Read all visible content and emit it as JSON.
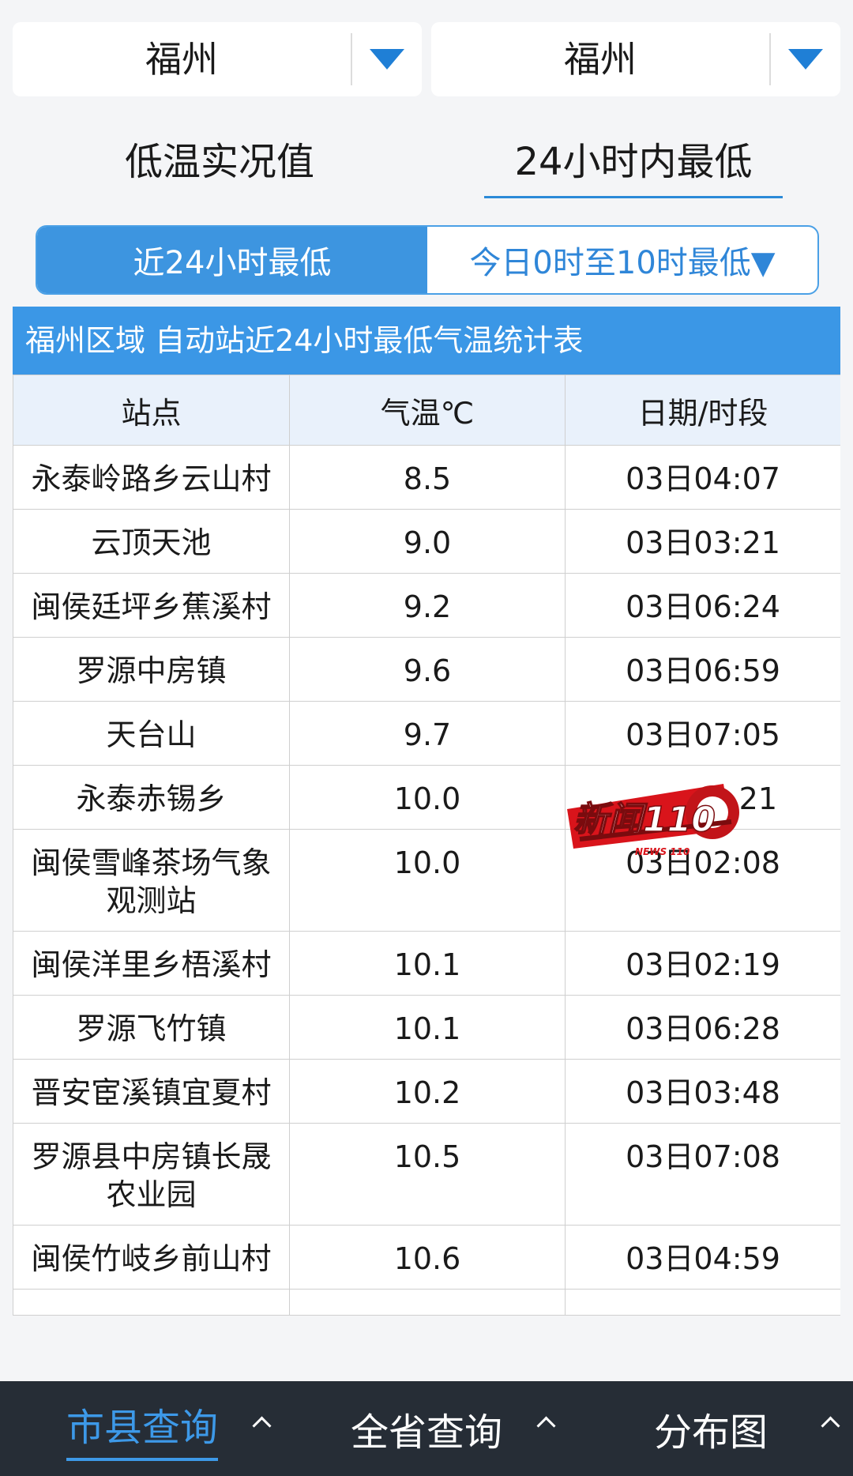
{
  "selectors": {
    "left": {
      "value": "福州"
    },
    "right": {
      "value": "福州"
    }
  },
  "mode_tabs": [
    {
      "label": "低温实况值",
      "active": false
    },
    {
      "label": "24小时内最低",
      "active": true
    }
  ],
  "segment": {
    "left_label": "近24小时最低",
    "right_label": "今日0时至10时最低▼"
  },
  "table": {
    "title": "福州区域 自动站近24小时最低气温统计表",
    "headers": [
      "站点",
      "气温℃",
      "日期/时段"
    ],
    "rows": [
      {
        "station": "永泰岭路乡云山村",
        "temp": "8.5",
        "time": "03日04:07"
      },
      {
        "station": "云顶天池",
        "temp": "9.0",
        "time": "03日03:21"
      },
      {
        "station": "闽侯廷坪乡蕉溪村",
        "temp": "9.2",
        "time": "03日06:24"
      },
      {
        "station": "罗源中房镇",
        "temp": "9.6",
        "time": "03日06:59"
      },
      {
        "station": "天台山",
        "temp": "9.7",
        "time": "03日07:05"
      },
      {
        "station": "永泰赤锡乡",
        "temp": "10.0",
        "time": "21"
      },
      {
        "station": "闽侯雪峰茶场气象观测站",
        "temp": "10.0",
        "time": "03日02:08"
      },
      {
        "station": "闽侯洋里乡梧溪村",
        "temp": "10.1",
        "time": "03日02:19"
      },
      {
        "station": "罗源飞竹镇",
        "temp": "10.1",
        "time": "03日06:28"
      },
      {
        "station": "晋安宦溪镇宜夏村",
        "temp": "10.2",
        "time": "03日03:48"
      },
      {
        "station": "罗源县中房镇长晟农业园",
        "temp": "10.5",
        "time": "03日07:08"
      },
      {
        "station": "闽侯竹岐乡前山村",
        "temp": "10.6",
        "time": "03日04:59"
      },
      {
        "station": "",
        "temp": "",
        "time": ""
      }
    ]
  },
  "watermark": {
    "text": "新闻110",
    "sub": "NEWS 110",
    "icon": "news110-logo"
  },
  "bottom_nav": [
    {
      "label": "市县查询",
      "active": true
    },
    {
      "label": "全省查询",
      "active": false
    },
    {
      "label": "分布图",
      "active": false
    }
  ]
}
